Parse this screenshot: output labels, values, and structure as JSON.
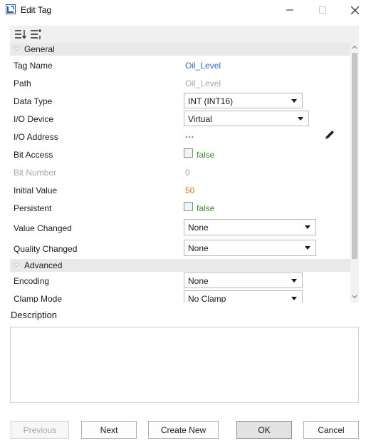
{
  "window": {
    "title": "Edit Tag",
    "icons": {
      "app": "app-logo-icon",
      "minimize": "minimize-icon",
      "maximize": "maximize-icon",
      "close": "close-icon"
    }
  },
  "toolbar": {
    "icons": [
      "sort-alphabetical-icon",
      "categorized-view-icon"
    ]
  },
  "sections": {
    "general": "General",
    "advanced": "Advanced"
  },
  "properties": {
    "tag_name": {
      "label": "Tag Name",
      "value": "Oil_Level"
    },
    "path": {
      "label": "Path",
      "value": "Oil_Level"
    },
    "data_type": {
      "label": "Data Type",
      "value": "INT (INT16)"
    },
    "io_device": {
      "label": "I/O Device",
      "value": "Virtual"
    },
    "io_address": {
      "label": "I/O Address",
      "value": "...",
      "icon": "pencil-icon"
    },
    "bit_access": {
      "label": "Bit Access",
      "value": "false",
      "checked": false
    },
    "bit_number": {
      "label": "Bit Number",
      "value": "0"
    },
    "initial_value": {
      "label": "Initial Value",
      "value": "50"
    },
    "persistent": {
      "label": "Persistent",
      "value": "false",
      "checked": false
    },
    "value_changed": {
      "label": "Value Changed",
      "value": "None"
    },
    "quality_changed": {
      "label": "Quality Changed",
      "value": "None"
    },
    "encoding": {
      "label": "Encoding",
      "value": "None"
    },
    "clamp_mode": {
      "label": "Clamp Mode",
      "value": "No Clamp"
    }
  },
  "description": {
    "label": "Description",
    "value": ""
  },
  "buttons": {
    "previous": "Previous",
    "next": "Next",
    "create_new": "Create New",
    "ok": "OK",
    "cancel": "Cancel"
  },
  "colors": {
    "link_value": "#2a6ebb",
    "readonly_value": "#a8a8a8",
    "numeric_value": "#e0731f",
    "boolean_value": "#3a8a2a",
    "section_header": "#e9e9e9"
  }
}
